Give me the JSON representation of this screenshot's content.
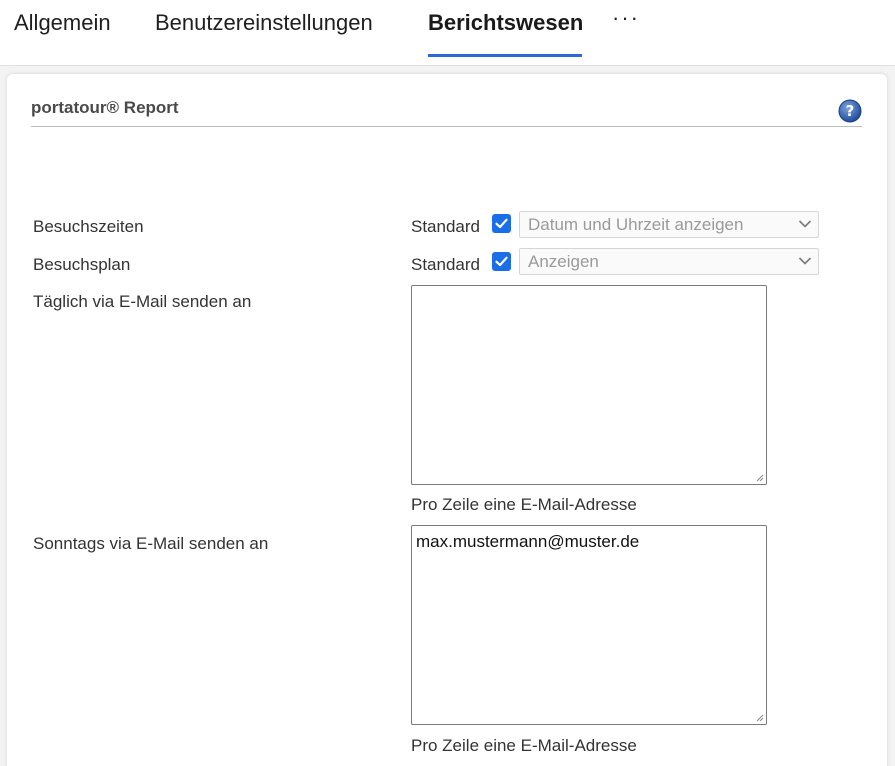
{
  "tabs": [
    {
      "label": "Allgemein",
      "active": false
    },
    {
      "label": "Benutzereinstellungen",
      "active": false
    },
    {
      "label": "Berichtswesen",
      "active": true
    },
    {
      "label": "···",
      "active": false
    }
  ],
  "section": {
    "title": "portatour® Report",
    "help_icon": "question-circle-icon"
  },
  "form": {
    "besuchszeiten": {
      "label": "Besuchszeiten",
      "standard_label": "Standard",
      "standard_checked": true,
      "select_value": "Datum und Uhrzeit anzeigen"
    },
    "besuchsplan": {
      "label": "Besuchsplan",
      "standard_label": "Standard",
      "standard_checked": true,
      "select_value": "Anzeigen"
    },
    "taeglich": {
      "label": "Täglich via E-Mail senden an",
      "value": "",
      "hint": "Pro Zeile eine E-Mail-Adresse"
    },
    "sonntags": {
      "label": "Sonntags via E-Mail senden an",
      "value": "max.mustermann@muster.de",
      "hint": "Pro Zeile eine E-Mail-Adresse"
    }
  },
  "colors": {
    "accent": "#2d6ad8",
    "checkbox": "#1a6fe8",
    "help_icon": "#2e5aa8"
  }
}
